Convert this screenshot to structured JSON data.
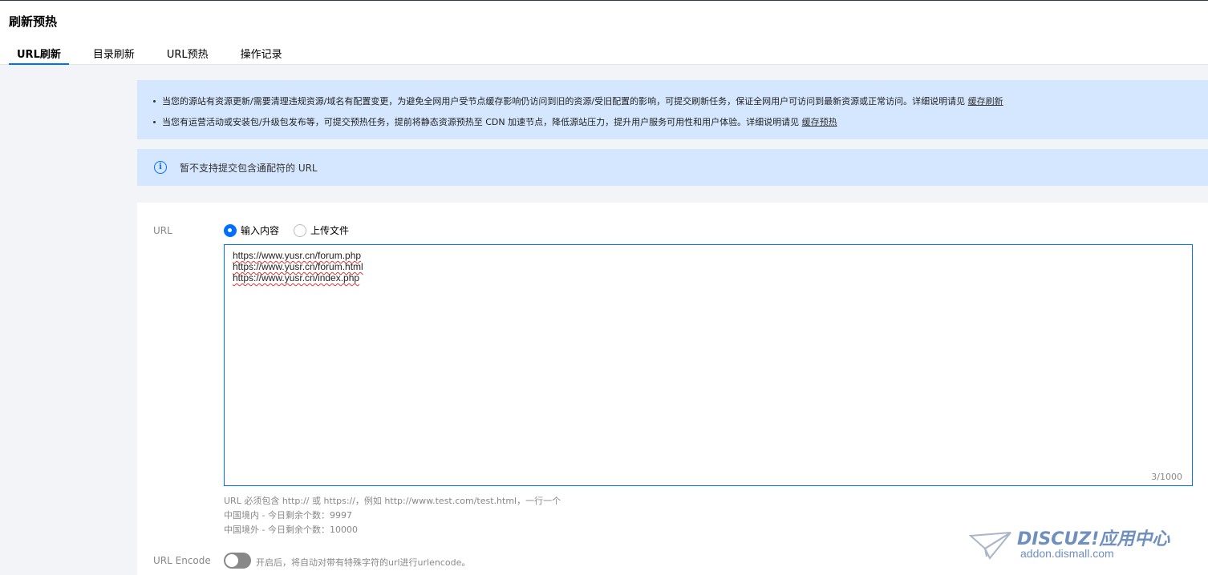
{
  "page": {
    "title": "刷新预热"
  },
  "tabs": [
    {
      "label": "URL刷新",
      "active": true
    },
    {
      "label": "目录刷新",
      "active": false
    },
    {
      "label": "URL预热",
      "active": false
    },
    {
      "label": "操作记录",
      "active": false
    }
  ],
  "notice": {
    "line1_text": "当您的源站有资源更新/需要清理违规资源/域名有配置变更，为避免全网用户受节点缓存影响仍访问到旧的资源/受旧配置的影响，可提交刷新任务，保证全网用户可访问到最新资源或正常访问。详细说明请见",
    "line1_link": "缓存刷新",
    "line2_text": "当您有运营活动或安装包/升级包发布等，可提交预热任务，提前将静态资源预热至 CDN 加速节点，降低源站压力，提升用户服务可用性和用户体验。详细说明请见",
    "line2_link": "缓存预热"
  },
  "info": {
    "icon": "info-icon",
    "text": "暂不支持提交包含通配符的 URL"
  },
  "form": {
    "url_label": "URL",
    "radio_input": "输入内容",
    "radio_upload": "上传文件",
    "selected_radio": "输入内容",
    "urls": [
      "https://www.yusr.cn/forum.php",
      "https://www.yusr.cn/forum.html",
      "https://www.yusr.cn/index.php"
    ],
    "counter": "3/1000",
    "hint_format": "URL 必须包含 http:// 或 https://，例如 http://www.test.com/test.html，一行一个",
    "hint_domestic": "中国境内 - 今日剩余个数：9997",
    "hint_overseas": "中国境外 - 今日剩余个数：10000",
    "encode_label": "URL Encode",
    "encode_enabled": false,
    "encode_desc": "开启后，将自动对带有特殊字符的url进行urlencode。"
  },
  "watermark": {
    "brand": "DISCUZ!应用中心",
    "domain": "addon.dismall.com"
  },
  "colors": {
    "accent": "#006eff",
    "notice_bg": "#d5e7ff",
    "page_bg": "#f3f4f7"
  }
}
